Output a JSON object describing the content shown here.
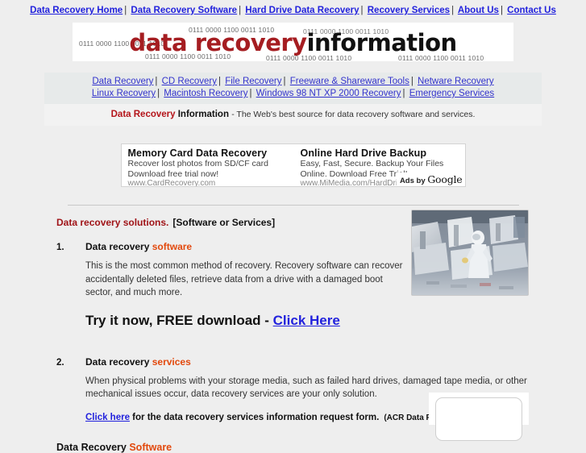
{
  "top_nav": {
    "items": [
      {
        "label": "Data Recovery Home"
      },
      {
        "label": "Data Recovery Software"
      },
      {
        "label": "Hard Drive Data Recovery"
      },
      {
        "label": "Recovery Services"
      },
      {
        "label": "About Us"
      },
      {
        "label": "Contact Us"
      }
    ],
    "separator": "|"
  },
  "banner": {
    "title_red": "data recovery",
    "title_black": "information",
    "binary_1": "0111 0000 1100 0011 1010",
    "binary_2": "0111 0000 1100 0011 1010",
    "binary_3": "0111 0000 1100 0011 1010",
    "binary_4": "0111 0000 1100 0011 1010",
    "binary_5": "0111 0000 1100 0011 1010",
    "binary_6": "0111 0000 1100 0011 1010"
  },
  "sub_nav": {
    "row1": [
      {
        "label": "Data Recovery"
      },
      {
        "label": "CD Recovery"
      },
      {
        "label": "File Recovery"
      },
      {
        "label": "Freeware & Shareware Tools"
      },
      {
        "label": "Netware Recovery"
      }
    ],
    "row2": [
      {
        "label": "Linux Recovery"
      },
      {
        "label": "Macintosh Recovery"
      },
      {
        "label": "Windows 98 NT XP 2000 Recovery"
      },
      {
        "label": "Emergency Services"
      }
    ],
    "separator": "|"
  },
  "tagline": {
    "brand_red": "Data Recovery",
    "brand_black": "Information",
    "description": "- The Web's best source for data recovery software and services."
  },
  "ads": {
    "badge_text": "Ads by",
    "badge_brand": "Google",
    "items": [
      {
        "title": "Memory Card Data Recovery",
        "line1": "Recover lost photos from SD/CF card",
        "line2": "Download free trial now!",
        "url": "www.CardRecovery.com"
      },
      {
        "title": "Online Hard Drive Backup",
        "line1": "Easy, Fast, Secure. Backup Your Files",
        "line2": "Online. Download Free Trial!",
        "url": "www.MiMedia.com/HardDrive"
      }
    ]
  },
  "main": {
    "section_title_red": "Data recovery solutions.",
    "section_title_black": "[Software or Services]",
    "items": [
      {
        "number": "1.",
        "head_plain": "Data recovery",
        "head_highlight": "software",
        "body": "This is the most common method of recovery.  Recovery software can recover accidentally deleted files, retrieve data from a drive with a damaged boot sector, and much more.",
        "cta_text": "Try it now, FREE download - ",
        "cta_link": "Click Here"
      },
      {
        "number": "2.",
        "head_plain": "Data recovery",
        "head_highlight": "services",
        "body": "When physical problems with your storage media, such as failed hard drives, damaged tape media, or other mechanical issues occur, data recovery services are your only solution.",
        "form_link": "Click here",
        "form_text": " for the data recovery services information request form.",
        "form_note": "(ACR Data Recovery)"
      }
    ],
    "footer_heading_plain": "Data Recovery",
    "footer_heading_highlight": "Software",
    "photo_alt": "cleanroom-technician"
  },
  "colors": {
    "link_blue": "#2222dd",
    "brand_red": "#a51d21",
    "highlight_orange": "#e2490d",
    "page_bg": "#eeeeee",
    "nav_band": "#e7eaea",
    "tag_band": "#f2f2f2"
  }
}
